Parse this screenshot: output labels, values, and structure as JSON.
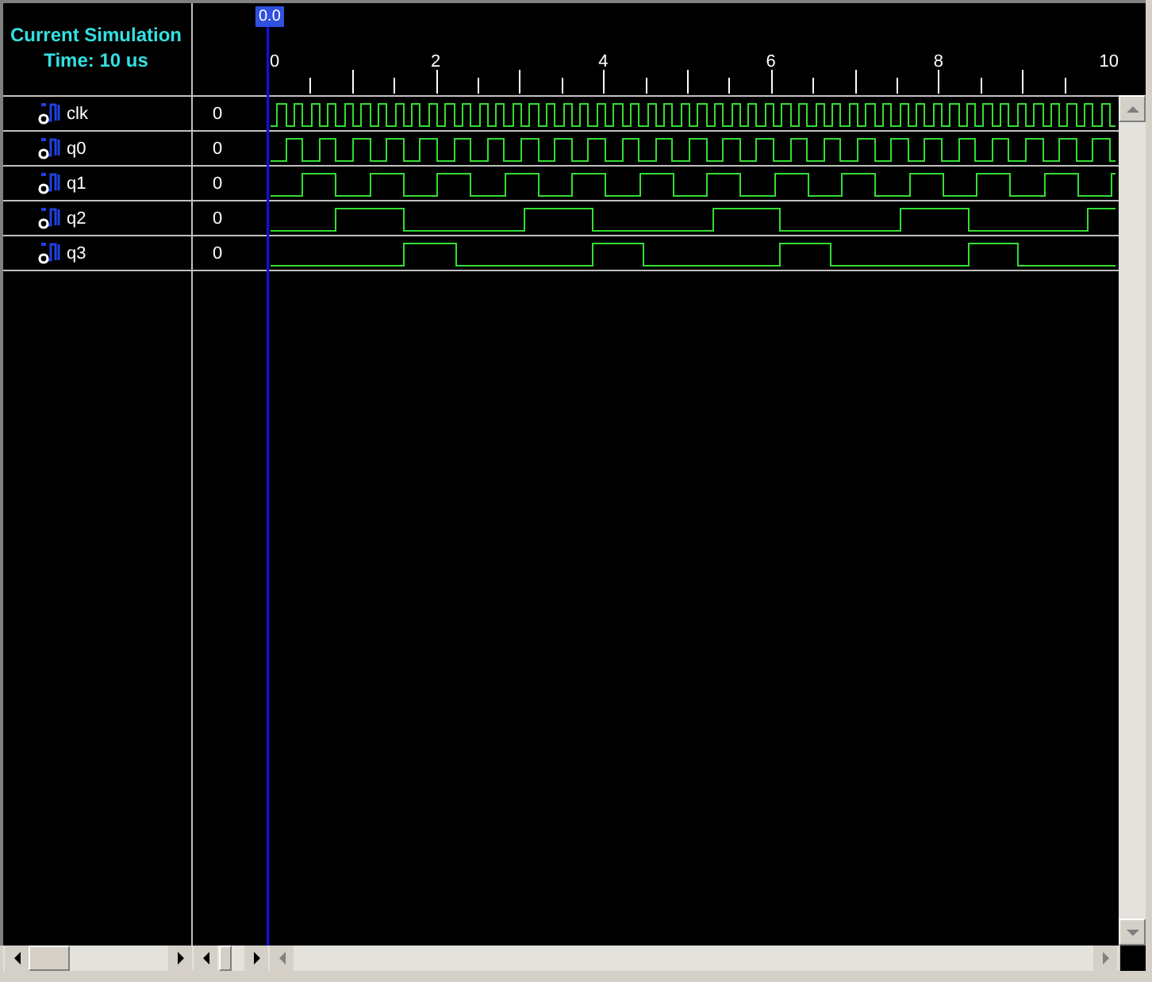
{
  "header": {
    "title": "Current Simulation Time: 10 us"
  },
  "cursor": {
    "label": "0.0"
  },
  "timeline": {
    "labels": [
      "0",
      "2",
      "4",
      "6",
      "8",
      "10"
    ]
  },
  "signals": [
    {
      "name": "clk",
      "value": "0"
    },
    {
      "name": "q0",
      "value": "0"
    },
    {
      "name": "q1",
      "value": "0"
    },
    {
      "name": "q2",
      "value": "0"
    },
    {
      "name": "q3",
      "value": "0"
    }
  ]
}
